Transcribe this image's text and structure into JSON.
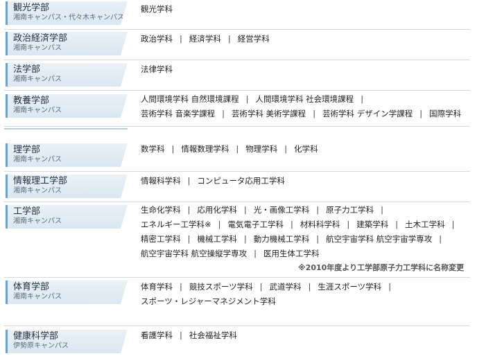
{
  "faculties": [
    {
      "name": "観光学部",
      "campus": "湘南キャンパス・代々木キャンパス",
      "lines": [
        [
          "観光学科"
        ]
      ]
    },
    {
      "name": "政治経済学部",
      "campus": "湘南キャンパス",
      "lines": [
        [
          "政治学科",
          "経済学科",
          "経営学科"
        ]
      ]
    },
    {
      "name": "法学部",
      "campus": "湘南キャンパス",
      "lines": [
        [
          "法律学科"
        ]
      ]
    },
    {
      "name": "教養学部",
      "campus": "湘南キャンパス",
      "lines": [
        [
          "人間環境学科 自然環境課程",
          "人間環境学科 社会環境課程",
          ""
        ],
        [
          "芸術学科 音楽学課程",
          "芸術学科 美術学課程",
          "芸術学科 デザイン学課程",
          "国際学科"
        ]
      ]
    },
    {
      "name": "理学部",
      "campus": "湘南キャンパス",
      "lines": [
        [
          "数学科",
          "情報数理学科",
          "物理学科",
          "化学科"
        ]
      ]
    },
    {
      "name": "情報理工学部",
      "campus": "湘南キャンパス",
      "lines": [
        [
          "情報科学科",
          "コンピュータ応用工学科"
        ]
      ]
    },
    {
      "name": "工学部",
      "campus": "湘南キャンパス",
      "lines": [
        [
          "生命化学科",
          "応用化学科",
          "光・画像工学科",
          "原子力工学科",
          ""
        ],
        [
          "エネルギー工学科※",
          "電気電子工学科",
          "材料科学科",
          "建築学科",
          "土木工学科",
          ""
        ],
        [
          "精密工学科",
          "機械工学科",
          "動力機械工学科",
          "航空宇宙学科 航空宇宙学専攻",
          ""
        ],
        [
          "航空宇宙学科 航空操縦学専攻",
          "医用生体工学科"
        ]
      ],
      "note": "※2010年度より工学部原子力工学科に名称変更"
    },
    {
      "name": "体育学部",
      "campus": "湘南キャンパス",
      "lines": [
        [
          "体育学科",
          "競技スポーツ学科",
          "武道学科",
          "生涯スポーツ学科",
          ""
        ],
        [
          "スポーツ・レジャーマネジメント学科"
        ]
      ]
    },
    {
      "name": "健康科学部",
      "campus": "伊勢原キャンパス",
      "lines": [
        [
          "看護学科",
          "社会福祉学科"
        ]
      ]
    }
  ]
}
